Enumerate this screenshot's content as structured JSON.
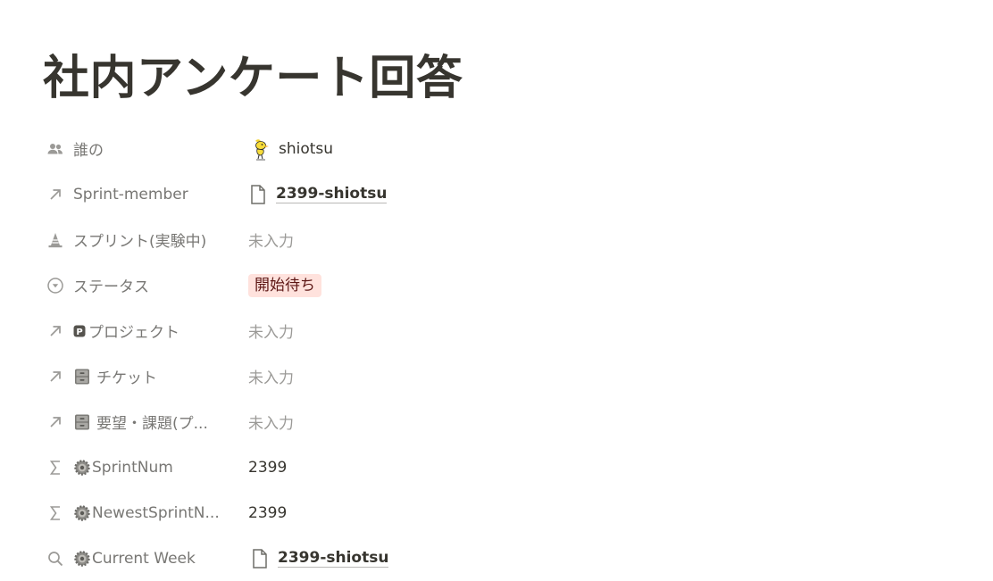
{
  "page": {
    "title": "社内アンケート回答"
  },
  "properties": [
    {
      "name": "誰の",
      "icon": "people-icon",
      "value_type": "person",
      "value": "shiotsu",
      "avatar": "bird-avatar"
    },
    {
      "name": "Sprint-member",
      "icon": "relation-arrow-icon",
      "value_type": "page-link",
      "value": "2399-shiotsu"
    },
    {
      "name": "スプリント(実験中)",
      "icon": "sprint-cone-icon",
      "value_type": "empty",
      "value": "未入力"
    },
    {
      "name": "ステータス",
      "icon": "status-icon",
      "value_type": "status",
      "value": "開始待ち",
      "color": "#ffe2dd"
    },
    {
      "name": "プロジェクト",
      "icon": "relation-arrow-icon",
      "emoji": "p-square-icon",
      "value_type": "empty",
      "value": "未入力"
    },
    {
      "name": "チケット",
      "icon": "relation-arrow-icon",
      "emoji": "file-cabinet-icon",
      "value_type": "empty",
      "value": "未入力"
    },
    {
      "name": "要望・課題(プ...",
      "icon": "relation-arrow-icon",
      "emoji": "file-cabinet-icon",
      "value_type": "empty",
      "value": "未入力"
    },
    {
      "name": "SprintNum",
      "icon": "formula-sigma-icon",
      "emoji": "gear-icon",
      "value_type": "number",
      "value": "2399"
    },
    {
      "name": "NewestSprintN...",
      "icon": "formula-sigma-icon",
      "emoji": "gear-icon",
      "value_type": "number",
      "value": "2399"
    },
    {
      "name": "Current Week",
      "icon": "rollup-search-icon",
      "emoji": "gear-icon",
      "value_type": "page-link",
      "value": "2399-shiotsu"
    }
  ],
  "colors": {
    "text": "#37352f",
    "muted": "#787774",
    "placeholder": "#9b9a97",
    "status_tag_bg": "#ffe2dd",
    "status_tag_text": "#5d1715"
  }
}
